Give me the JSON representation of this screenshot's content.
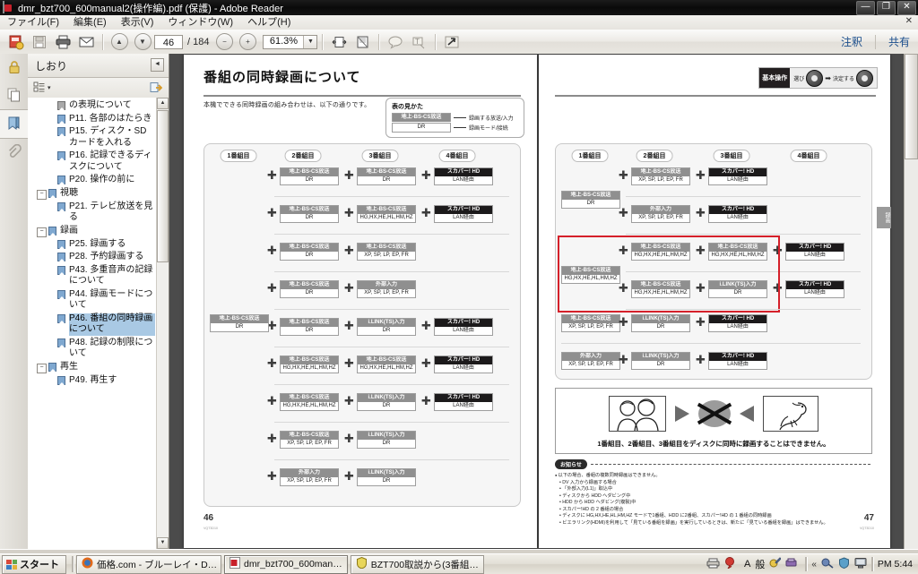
{
  "window": {
    "title": "dmr_bzt700_600manual2(操作編).pdf (保護) - Adobe Reader",
    "minimize": "—",
    "maximize": "❐",
    "close": "✕"
  },
  "menu": {
    "items": [
      "ファイル(F)",
      "編集(E)",
      "表示(V)",
      "ウィンドウ(W)",
      "ヘルプ(H)"
    ],
    "close_doc": "✕"
  },
  "toolbar": {
    "icons": [
      "open-icon",
      "save-icon",
      "print-icon",
      "email-icon"
    ],
    "prev_page": "▲",
    "next_page": "▼",
    "page_value": "46",
    "page_total": "/  184",
    "zoom_out": "−",
    "zoom_in": "+",
    "zoom_value": "61.3%",
    "zoom_caret": "▼",
    "fit_width": "fit-width-icon",
    "fit_page": "fit-page-icon",
    "comment_tool": "comment-icon",
    "stamp_tool": "stamp-icon",
    "fullscreen": "fullscreen-icon",
    "annotation_link": "注釈",
    "share_link": "共有"
  },
  "rail": {
    "items": [
      "lock-icon",
      "pages-icon",
      "bookmark-icon",
      "attachment-icon"
    ],
    "selected_index": 2
  },
  "bookmarks": {
    "panel_title": "しおり",
    "collapse": "◄",
    "options_icon": "options-list-icon",
    "options_caret": "▾",
    "expand_all_icon": "expand-bookmarks-icon",
    "scroll_up": "▲",
    "scroll_down": "▼",
    "items": [
      {
        "label": "の表現について",
        "level": 2,
        "expander": "",
        "selected": false,
        "partial": true
      },
      {
        "label": "P11. 各部のはたらき",
        "level": 2,
        "expander": "",
        "selected": false
      },
      {
        "label": "P15. ディスク・SD カードを入れる",
        "level": 2,
        "expander": "",
        "selected": false
      },
      {
        "label": "P16. 記録できるディスクについて",
        "level": 2,
        "expander": "",
        "selected": false
      },
      {
        "label": "P20. 操作の前に",
        "level": 2,
        "expander": "",
        "selected": false
      },
      {
        "label": "視聴",
        "level": 1,
        "expander": "−",
        "selected": false
      },
      {
        "label": "P21. テレビ放送を見る",
        "level": 2,
        "expander": "",
        "selected": false
      },
      {
        "label": "録画",
        "level": 1,
        "expander": "−",
        "selected": false
      },
      {
        "label": "P25. 録画する",
        "level": 2,
        "expander": "",
        "selected": false
      },
      {
        "label": "P28. 予約録画する",
        "level": 2,
        "expander": "",
        "selected": false
      },
      {
        "label": "P43. 多重音声の記録について",
        "level": 2,
        "expander": "",
        "selected": false
      },
      {
        "label": "P44. 録画モードについて",
        "level": 2,
        "expander": "",
        "selected": false
      },
      {
        "label": "P46. 番組の同時録画について",
        "level": 2,
        "expander": "",
        "selected": true
      },
      {
        "label": "P48. 記録の制限について",
        "level": 2,
        "expander": "",
        "selected": false
      },
      {
        "label": "再生",
        "level": 1,
        "expander": "−",
        "selected": false
      },
      {
        "label": "P49. 再生す",
        "level": 2,
        "expander": "",
        "selected": false
      }
    ]
  },
  "document": {
    "left_page": {
      "heading": "番組の同時録画について",
      "lead": "本機でできる同時録画の組み合わせは、以下の通りです。",
      "legend": {
        "title": "表の見かた",
        "row1_cell_top": "地上-BS-CS放送",
        "row1_label": "録画する放送/入力",
        "row2_cell_bottom": "DR",
        "row2_label": "録画モード/接続"
      },
      "column_headers": [
        "1番組目",
        "2番組目",
        "3番組目",
        "4番組目"
      ],
      "first_program": {
        "top": "地上-BS-CS放送",
        "bottom": "DR"
      },
      "plus_symbol": "✚",
      "rows": [
        [
          {
            "top": "地上-BS-CS放送",
            "bottom": "DR",
            "dark": false
          },
          {
            "top": "地上-BS-CS放送",
            "bottom": "DR",
            "dark": false
          },
          {
            "top": "スカパー! HD",
            "bottom": "LAN経由",
            "dark": true
          }
        ],
        [
          {
            "top": "地上-BS-CS放送",
            "bottom": "DR",
            "dark": false
          },
          {
            "top": "地上-BS-CS放送",
            "bottom": "HG,HX,HE,HL,HM,HZ",
            "dark": false
          },
          {
            "top": "スカパー! HD",
            "bottom": "LAN経由",
            "dark": true
          }
        ],
        [
          {
            "top": "地上-BS-CS放送",
            "bottom": "DR",
            "dark": false
          },
          {
            "top": "地上-BS-CS放送",
            "bottom": "XP, SP, LP, EP, FR",
            "dark": false
          }
        ],
        [
          {
            "top": "地上-BS-CS放送",
            "bottom": "DR",
            "dark": false
          },
          {
            "top": "外部入力",
            "bottom": "XP, SP, LP, EP, FR",
            "dark": false
          }
        ],
        [
          {
            "top": "地上-BS-CS放送",
            "bottom": "DR",
            "dark": false
          },
          {
            "top": "i.LINK(TS)入力",
            "bottom": "DR",
            "dark": false
          },
          {
            "top": "スカパー! HD",
            "bottom": "LAN経由",
            "dark": true
          }
        ],
        [
          {
            "top": "地上-BS-CS放送",
            "bottom": "HG,HX,HE,HL,HM,HZ",
            "dark": false
          },
          {
            "top": "地上-BS-CS放送",
            "bottom": "HG,HX,HE,HL,HM,HZ",
            "dark": false
          },
          {
            "top": "スカパー! HD",
            "bottom": "LAN経由",
            "dark": true
          }
        ],
        [
          {
            "top": "地上-BS-CS放送",
            "bottom": "HG,HX,HE,HL,HM,HZ",
            "dark": false
          },
          {
            "top": "i.LINK(TS)入力",
            "bottom": "DR",
            "dark": false
          },
          {
            "top": "スカパー! HD",
            "bottom": "LAN経由",
            "dark": true
          }
        ],
        [
          {
            "top": "地上-BS-CS放送",
            "bottom": "XP, SP, LP, EP, FR",
            "dark": false
          },
          {
            "top": "i.LINK(TS)入力",
            "bottom": "DR",
            "dark": false
          }
        ],
        [
          {
            "top": "外部入力",
            "bottom": "XP, SP, LP, EP, FR",
            "dark": false
          },
          {
            "top": "i.LINK(TS)入力",
            "bottom": "DR",
            "dark": false
          }
        ]
      ],
      "page_number": "46",
      "page_code": "VQT3D10"
    },
    "right_page": {
      "basic_op": {
        "badge": "基本操作",
        "select_label": "選び",
        "arrow": "➡",
        "decide_label": "決定する"
      },
      "column_headers": [
        "1番組目",
        "2番組目",
        "3番組目",
        "4番組目"
      ],
      "group1_first": {
        "top": "地上-BS-CS放送",
        "bottom": "DR"
      },
      "group2_first": {
        "top": "地上-BS-CS放送",
        "bottom": "HG,HX,HE,HL,HM,HZ"
      },
      "rows_group1": [
        [
          {
            "top": "地上-BS-CS放送",
            "bottom": "XP, SP, LP, EP, FR",
            "dark": false
          },
          {
            "top": "スカパー! HD",
            "bottom": "LAN経由",
            "dark": true
          }
        ],
        [
          {
            "top": "外部入力",
            "bottom": "XP, SP, LP, EP, FR",
            "dark": false
          },
          {
            "top": "スカパー! HD",
            "bottom": "LAN経由",
            "dark": true
          }
        ]
      ],
      "rows_group2_highlighted": [
        [
          {
            "top": "地上-BS-CS放送",
            "bottom": "HG,HX,HE,HL,HM,HZ",
            "dark": false
          },
          {
            "top": "地上-BS-CS放送",
            "bottom": "HG,HX,HE,HL,HM,HZ",
            "dark": false
          },
          {
            "top": "スカパー! HD",
            "bottom": "LAN経由",
            "dark": true
          }
        ],
        [
          {
            "top": "地上-BS-CS放送",
            "bottom": "HG,HX,HE,HL,HM,HZ",
            "dark": false
          },
          {
            "top": "i.LINK(TS)入力",
            "bottom": "DR",
            "dark": false
          },
          {
            "top": "スカパー! HD",
            "bottom": "LAN経由",
            "dark": true
          }
        ]
      ],
      "rows_group3": [
        [
          {
            "top": "地上-BS-CS放送",
            "bottom": "XP, SP, LP, EP, FR",
            "dark": false
          },
          {
            "top": "i.LINK(TS)入力",
            "bottom": "DR",
            "dark": false
          },
          {
            "top": "スカパー! HD",
            "bottom": "LAN経由",
            "dark": true
          }
        ],
        [
          {
            "top": "外部入力",
            "bottom": "XP, SP, LP, EP, FR",
            "dark": false
          },
          {
            "top": "i.LINK(TS)入力",
            "bottom": "DR",
            "dark": false
          },
          {
            "top": "スカパー! HD",
            "bottom": "LAN経由",
            "dark": true
          }
        ]
      ],
      "warning": {
        "caption": "1番組目、2番組目、3番組目をディスクに同時に録画することはできません。",
        "images": [
          "people-photo",
          "right-arrow",
          "x-disc",
          "left-arrow",
          "dinosaur-photo"
        ]
      },
      "notice": {
        "badge": "お知らせ",
        "lines": [
          "以下の場合、番組の複数同時録画はできません。",
          "DV 入力から録画する場合",
          "「外部入力(L1)」取込中",
          "ディスクから HDD へダビング中",
          "HDD から HDD へダビング(複製)中",
          "スカパー!HD の 2 番組の場合",
          "ディスクに HG,HX,HE,HL,HM,HZ モードで1番組、HDD に2番組、スカパー!HD の 1 番組の同時録画",
          "ビエラリンク(HDMI)を利用して「見ている番組を録画」を実行しているときは、新たに「見ている番組を録画」はできません。"
        ]
      },
      "side_tab": "録画",
      "page_number": "47",
      "page_code": "VQT3D10"
    }
  },
  "taskbar": {
    "start_label": "スタート",
    "items": [
      {
        "label": "価格.com - ブルーレイ・D…",
        "icon": "firefox-icon",
        "active": false
      },
      {
        "label": "dmr_bzt700_600man…",
        "icon": "pdf-icon",
        "active": true
      },
      {
        "label": "BZT700取説から(3番組…",
        "icon": "viewer-icon",
        "active": false
      }
    ],
    "tray_icons": [
      "printer-icon",
      "balloon-icon",
      "ime-a-icon",
      "ime-kana-icon",
      "ime-pencil-icon",
      "ime-tool-icon"
    ],
    "ime_a": "A",
    "ime_kana": "般",
    "tray_expand": "«",
    "hidden_icons": [
      "network-icon",
      "shield-icon",
      "monitor-icon"
    ],
    "clock": "PM 5:44"
  },
  "colors": {
    "accent_red": "#d5202a",
    "selection_blue": "#a9c9e4",
    "link_blue": "#1b4e8c",
    "cell_header_gray": "#8f8f8f",
    "cell_header_dark": "#1c1a1b"
  }
}
